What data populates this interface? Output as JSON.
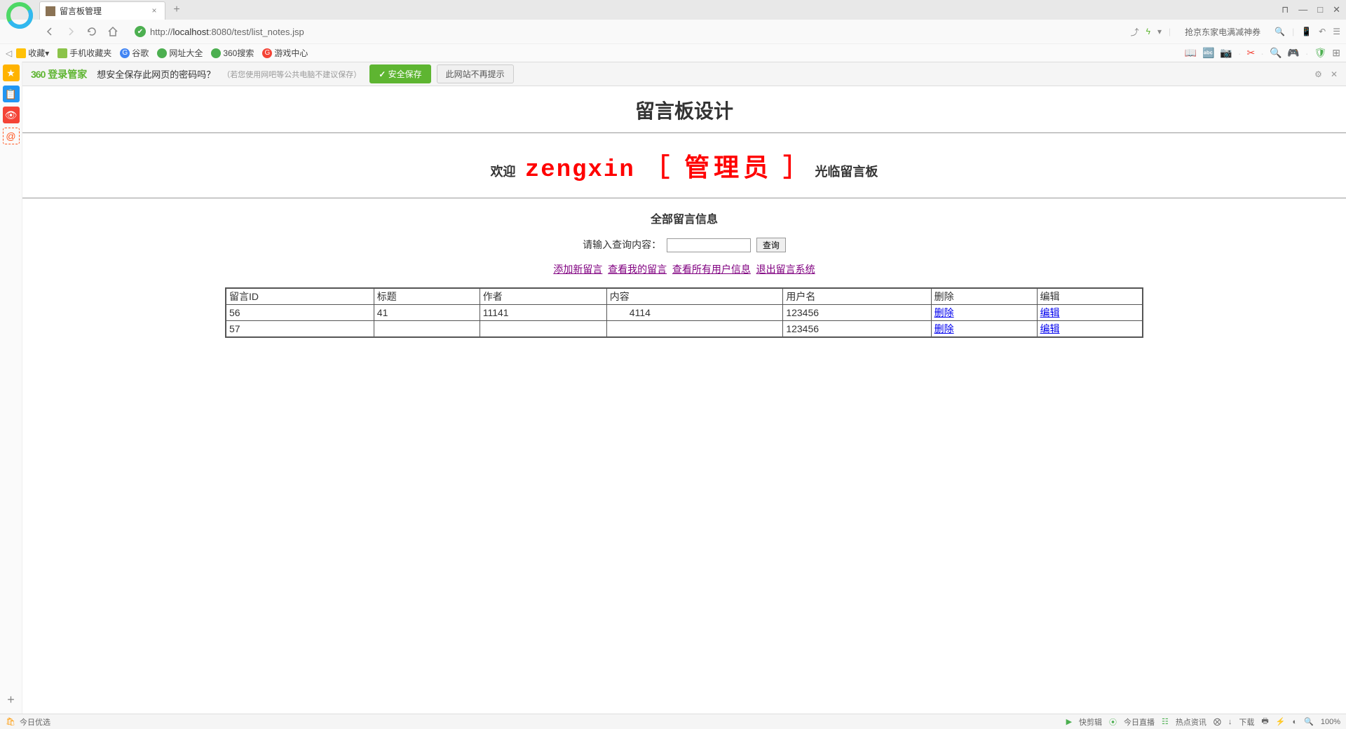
{
  "tab": {
    "title": "留言板管理"
  },
  "window_controls": {
    "mini": "⊓",
    "min": "—",
    "max": "□",
    "close": "✕"
  },
  "nav": {
    "url_prefix": "http://",
    "url_host": "localhost",
    "url_port": ":8080",
    "url_path": "/test/list_notes.jsp"
  },
  "promo": "抢京东家电满减神券",
  "bookmarks": {
    "fav": "收藏",
    "mobile": "手机收藏夹",
    "google": "谷歌",
    "sites": "网址大全",
    "s360": "360搜索",
    "game": "游戏中心"
  },
  "password_bar": {
    "logo_360": "360",
    "logo_text": "登录管家",
    "question": "想安全保存此网页的密码吗？",
    "hint": "（若您使用网吧等公共电脑不建议保存）",
    "save_btn": "安全保存",
    "no_btn": "此网站不再提示"
  },
  "page": {
    "title": "留言板设计",
    "welcome_prefix": "欢迎",
    "welcome_user": "zengxin",
    "welcome_role": "［ 管理员 ］",
    "welcome_suffix": "光临留言板",
    "sub_title": "全部留言信息",
    "search_label": "请输入查询内容：",
    "search_btn": "查询"
  },
  "links": {
    "add": "添加新留言",
    "mine": "查看我的留言",
    "all_users": "查看所有用户信息",
    "logout": "退出留言系统"
  },
  "table": {
    "headers": {
      "id": "留言ID",
      "title": "标题",
      "author": "作者",
      "content": "内容",
      "user": "用户名",
      "del": "删除",
      "edit": "编辑"
    },
    "rows": [
      {
        "id": "56",
        "title": "41",
        "author": "11141",
        "content": "　　4114",
        "user": "123456",
        "del": "删除",
        "edit": "编辑"
      },
      {
        "id": "57",
        "title": "",
        "author": "",
        "content": "",
        "user": "123456",
        "del": "删除",
        "edit": "编辑"
      }
    ]
  },
  "status": {
    "today": "今日优选",
    "cut": "快剪辑",
    "live": "今日直播",
    "hot": "热点资讯",
    "dl": "下载",
    "zoom": "100%"
  }
}
